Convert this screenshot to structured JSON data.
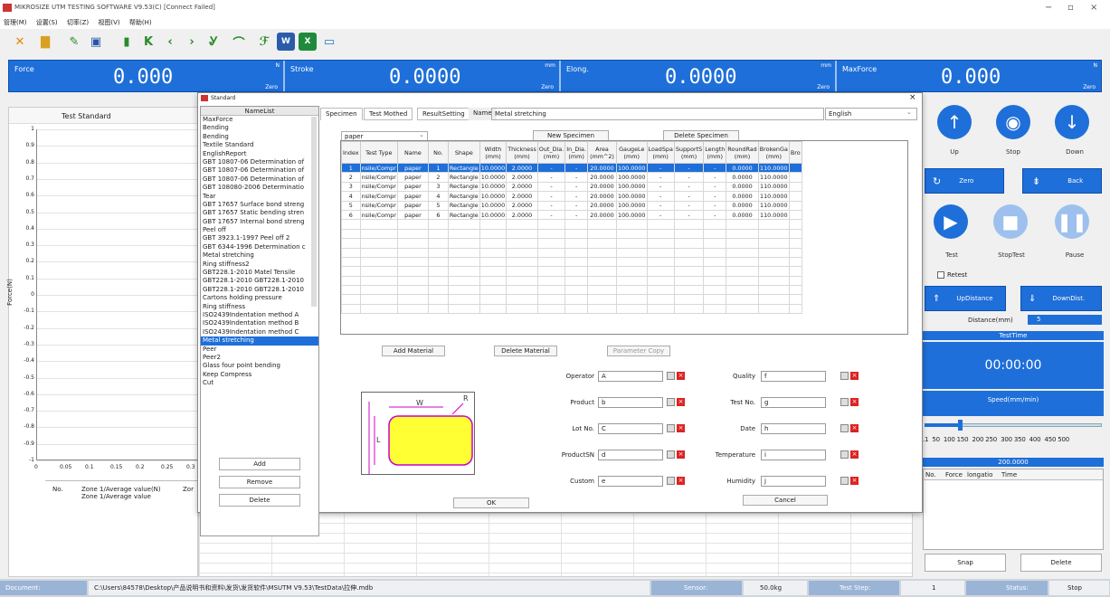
{
  "window": {
    "title": "MIKROSIZE UTM TESTING SOFTWARE V9.53(C)  [Connect Failed]",
    "minimize": "−",
    "restore": "▫",
    "close": "×"
  },
  "menu": [
    "管理(M)",
    "设置(S)",
    "切率(Z)",
    "视图(V)",
    "帮助(H)"
  ],
  "readouts": [
    {
      "label": "Force",
      "value": "0.000",
      "unit": "N",
      "zero": "Zero"
    },
    {
      "label": "Stroke",
      "value": "0.0000",
      "unit": "mm",
      "zero": "Zero"
    },
    {
      "label": "Elong.",
      "value": "0.0000",
      "unit": "mm",
      "zero": "Zero"
    },
    {
      "label": "MaxForce",
      "value": "0.000",
      "unit": "N",
      "zero": "Zero"
    }
  ],
  "left": {
    "test_standard": "Test Standard",
    "ylabel": "Force(N)",
    "yticks": [
      "1",
      "0.9",
      "0.8",
      "0.7",
      "0.6",
      "0.5",
      "0.4",
      "0.3",
      "0.2",
      "0.1",
      "0",
      "-0.1",
      "-0.2",
      "-0.3",
      "-0.4",
      "-0.5",
      "-0.6",
      "-0.7",
      "-0.8",
      "-0.9",
      "-1"
    ],
    "xticks": [
      "0",
      "0.05",
      "0.1",
      "0.15",
      "0.2",
      "0.25",
      "0.3"
    ],
    "zone_cols": [
      "No.",
      "Zone 1/Average value(N)\nZone 1/Average value",
      "Zor"
    ]
  },
  "dialog": {
    "title": "Standard",
    "close": "×",
    "namelist_header": "NameList",
    "names": [
      "MaxForce",
      "Bending",
      "Bending",
      "Textile Standard",
      "EnglishReport",
      "GBT 10807-06 Determination of",
      "GBT 10807-06 Determination of",
      "GBT 10807-06 Determination of",
      "GBT 108080-2006 Determinatio",
      "Tear",
      "GBT 17657 Surface bond streng",
      "GBT 17657 Static bending stren",
      "GBT 17657 Internal bond streng",
      "Peel off",
      "GBT 3923.1-1997 Peel off 2",
      "GBT 6344-1996 Determination c",
      "Metal stretching",
      "Ring stiffness2",
      "GBT228.1-2010 Matel Tensile",
      "GBT228.1-2010 GBT228.1-2010",
      "GBT228.1-2010 GBT228.1-2010",
      "Cartons holding pressure",
      "Ring stiffness",
      "ISO2439Indentation method A",
      "ISO2439Indentation method B",
      "ISO2439Indentation method C",
      "Metal stretching",
      "Peer",
      "Peer2",
      "Glass four point bending",
      "Keep Compress",
      "Cut"
    ],
    "selected_index": 26,
    "tabs": [
      "Specimen",
      "Test Mothed",
      "ResultSetting",
      "Name"
    ],
    "name_value": "Metal stretching",
    "language": "English",
    "material": "paper",
    "new_specimen": "New Specimen",
    "delete_specimen": "Delete Specimen",
    "table_headers": [
      "Index",
      "Test Type",
      "Name",
      "No.",
      "Shape",
      "Width\n(mm)",
      "Thickness\n(mm)",
      "Out_Dia.\n(mm)",
      "In_Dia.\n(mm)",
      "Area\n(mm^2)",
      "GaugeLe\n(mm)",
      "LoadSpa\n(mm)",
      "SupportS\n(mm)",
      "Length\n(mm)",
      "RoundRad\n(mm)",
      "BrokenGa\n(mm)",
      "Bro"
    ],
    "rows": [
      [
        "1",
        "nsile/Compr",
        "paper",
        "1",
        "Rectangle",
        "10.0000",
        "2.0000",
        "-",
        "-",
        "20.0000",
        "100.0000",
        "-",
        "-",
        "-",
        "0.0000",
        "110.0000",
        ""
      ],
      [
        "2",
        "nsile/Compr",
        "paper",
        "2",
        "Rectangle",
        "10.0000",
        "2.0000",
        "-",
        "-",
        "20.0000",
        "100.0000",
        "-",
        "-",
        "-",
        "0.0000",
        "110.0000",
        ""
      ],
      [
        "3",
        "nsile/Compr",
        "paper",
        "3",
        "Rectangle",
        "10.0000",
        "2.0000",
        "-",
        "-",
        "20.0000",
        "100.0000",
        "-",
        "-",
        "-",
        "0.0000",
        "110.0000",
        ""
      ],
      [
        "4",
        "nsile/Compr",
        "paper",
        "4",
        "Rectangle",
        "10.0000",
        "2.0000",
        "-",
        "-",
        "20.0000",
        "100.0000",
        "-",
        "-",
        "-",
        "0.0000",
        "110.0000",
        ""
      ],
      [
        "5",
        "nsile/Compr",
        "paper",
        "5",
        "Rectangle",
        "10.0000",
        "2.0000",
        "-",
        "-",
        "20.0000",
        "100.0000",
        "-",
        "-",
        "-",
        "0.0000",
        "110.0000",
        ""
      ],
      [
        "6",
        "nsile/Compr",
        "paper",
        "6",
        "Rectangle",
        "10.0000",
        "2.0000",
        "-",
        "-",
        "20.0000",
        "100.0000",
        "-",
        "-",
        "-",
        "0.0000",
        "110.0000",
        ""
      ]
    ],
    "add_material": "Add Material",
    "delete_material": "Delete  Material",
    "parameter_copy": "Parameter Copy",
    "fields_left": [
      {
        "label": "Operator",
        "value": "A"
      },
      {
        "label": "Product",
        "value": "b"
      },
      {
        "label": "Lot No.",
        "value": "C"
      },
      {
        "label": "ProductSN",
        "value": "d"
      },
      {
        "label": "Custom",
        "value": "e"
      }
    ],
    "fields_right": [
      {
        "label": "Quality",
        "value": "f"
      },
      {
        "label": "Test No.",
        "value": "g"
      },
      {
        "label": "Date",
        "value": "h"
      },
      {
        "label": "Temperature",
        "value": "i"
      },
      {
        "label": "Humidity",
        "value": "j"
      }
    ],
    "diagram_w": "W",
    "diagram_r": "R",
    "diagram_l": "L",
    "add": "Add",
    "remove": "Remove",
    "delete": "Delete",
    "ok": "OK",
    "cancel": "Cancel"
  },
  "right": {
    "up": "Up",
    "stop": "Stop",
    "down": "Down",
    "zero": "Zero",
    "back": "Back",
    "test": "Test",
    "stoptest": "StopTest",
    "pause": "Pause",
    "retest": "Retest",
    "updistance": "UpDistance",
    "downdist": "DownDist.",
    "distance_label": "Distance(mm)",
    "distance_value": "5",
    "testtime_label": "TestTime",
    "testtime": "00:00:00",
    "speed_label": "Speed(mm/min)",
    "speed_ticks": ".1  50  100 150  200 250  300 350  400  450 500",
    "speed_value": "200.0000",
    "speed_level": 0.2,
    "mini_cols": [
      "No.",
      "Force",
      "longatio",
      "Time"
    ],
    "snap": "Snap",
    "delete": "Delete"
  },
  "status": {
    "document_label": "Document:",
    "document": "C:\\Users\\84578\\Desktop\\产品说明书和资料\\发货\\发货软件\\MSUTM V9.53\\TestData\\拉伸.mdb",
    "sensor_label": "Sensor:",
    "sensor": "50.0kg",
    "step_label": "Test Step:",
    "step": "1",
    "status_label": "Status:",
    "status": "Stop"
  },
  "colors": {
    "accent": "#1e6fd9",
    "selection": "#1e6fd9",
    "diagram_fill": "#ffff33",
    "diagram_border": "#cc00cc"
  }
}
